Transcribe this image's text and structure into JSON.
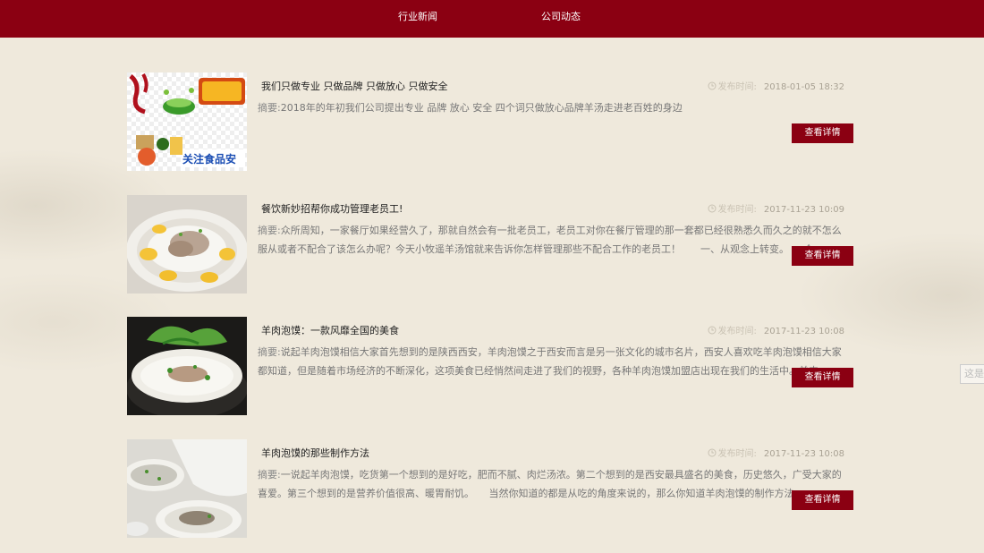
{
  "nav": {
    "items": [
      {
        "label": "行业新闻"
      },
      {
        "label": "公司动态"
      }
    ]
  },
  "side_tag": "这是",
  "news": [
    {
      "title": "我们只做专业 只做品牌 只做放心 只做安全",
      "date_label": "发布时间:",
      "date": "2018-01-05 18:32",
      "summary_label": "摘要:",
      "summary": "2018年的年初我们公司提出专业 品牌 放心 安全 四个词只做放心品牌羊汤走进老百姓的身边",
      "button": "查看详情"
    },
    {
      "title": "餐饮新妙招帮你成功管理老员工!",
      "date_label": "发布时间:",
      "date": "2017-11-23 10:09",
      "summary_label": "摘要:",
      "summary": "众所周知，一家餐厅如果经营久了，那就自然会有一批老员工，老员工对你在餐厅管理的那一套都已经很熟悉久而久之的就不怎么服从或者不配合了该怎么办呢？今天小牧遥羊汤馆就来告诉你怎样管理那些不配合工作的老员工！　　一、从观念上转变。　　个...",
      "button": "查看详情"
    },
    {
      "title": "羊肉泡馍：一款风靡全国的美食",
      "date_label": "发布时间:",
      "date": "2017-11-23 10:08",
      "summary_label": "摘要:",
      "summary": "说起羊肉泡馍相信大家首先想到的是陕西西安，羊肉泡馍之于西安而言是另一张文化的城市名片，西安人喜欢吃羊肉泡馍相信大家都知道，但是随着市场经济的不断深化，这项美食已经悄然间走进了我们的视野，各种羊肉泡馍加盟店出现在我们的生活中。羊肉...",
      "button": "查看详情"
    },
    {
      "title": "羊肉泡馍的那些制作方法",
      "date_label": "发布时间:",
      "date": "2017-11-23 10:08",
      "summary_label": "摘要:",
      "summary": "一说起羊肉泡馍，吃货第一个想到的是好吃，肥而不腻、肉烂汤浓。第二个想到的是西安最具盛名的美食，历史悠久，广受大家的喜爱。第三个想到的是营养价值很高、暖胃耐饥。　　当然你知道的都是从吃的角度来说的，那么你知道羊肉泡馍的制作方法...",
      "button": "查看详情"
    }
  ],
  "colors": {
    "brand_red": "#8b0012",
    "background": "#efe9dc"
  }
}
